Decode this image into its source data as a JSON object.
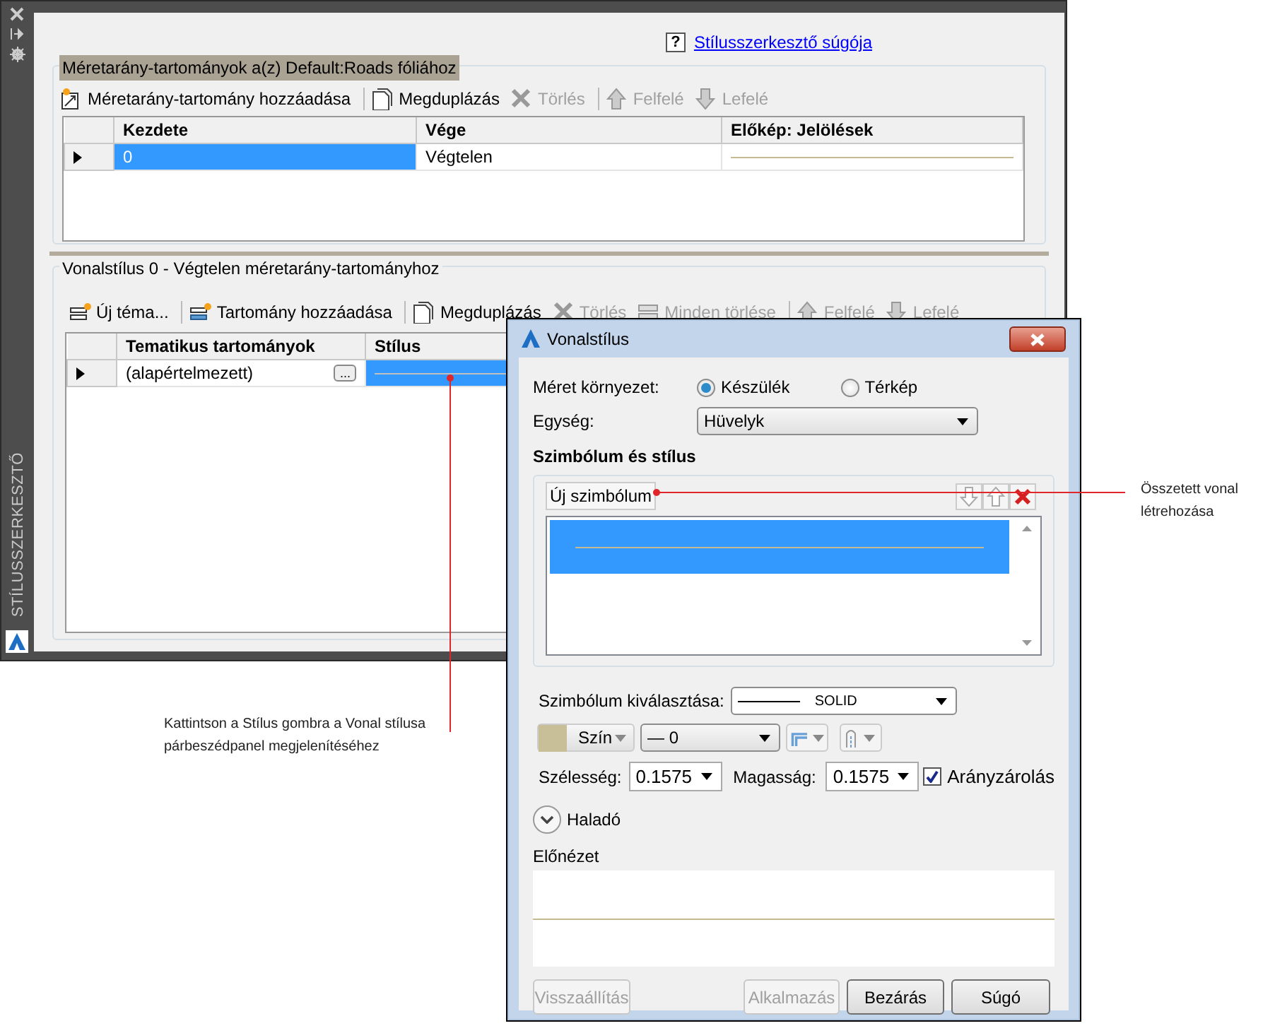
{
  "palette": {
    "side_title": "STÍLUSSZERKESZTŐ",
    "help_icon": "?",
    "help_link": "Stílusszerkesztő súgója"
  },
  "scale_ranges": {
    "title": "Méretarány-tartományok a(z) Default:Roads fóliához",
    "toolbar": [
      {
        "kind": "add",
        "label": "Méretarány-tartomány hozzáadása",
        "disabled": false
      },
      {
        "kind": "duplicate",
        "label": "Megduplázás",
        "disabled": false
      },
      {
        "kind": "delete",
        "label": "Törlés",
        "disabled": true
      },
      {
        "kind": "up",
        "label": "Felfelé",
        "disabled": true
      },
      {
        "kind": "down",
        "label": "Lefelé",
        "disabled": true
      }
    ],
    "columns": [
      "Kezdete",
      "Vége",
      "Előkép: Jelölések"
    ],
    "rows": [
      {
        "current": true,
        "cells": [
          {
            "kind": "text",
            "text": "0",
            "selected": true
          },
          {
            "kind": "text",
            "text": "Végtelen",
            "selected": false
          },
          {
            "kind": "preview",
            "selected": false
          }
        ]
      }
    ]
  },
  "line_styles": {
    "title": "Vonalstílus 0 - Végtelen méretarány-tartományhoz",
    "toolbar": [
      {
        "kind": "new-theme",
        "label": "Új téma...",
        "disabled": false
      },
      {
        "kind": "add-range",
        "label": "Tartomány hozzáadása",
        "disabled": false
      },
      {
        "kind": "duplicate",
        "label": "Megduplázás",
        "disabled": false
      },
      {
        "kind": "delete",
        "label": "Törlés",
        "disabled": true
      },
      {
        "kind": "delete-all",
        "label": "Minden törlése",
        "disabled": true
      },
      {
        "kind": "up",
        "label": "Felfelé",
        "disabled": true
      },
      {
        "kind": "down",
        "label": "Lefelé",
        "disabled": true
      }
    ],
    "columns": [
      "Tematikus tartományok",
      "Stílus"
    ],
    "rows": [
      {
        "current": true,
        "cells": [
          {
            "kind": "browse",
            "text": "(alapértelmezett)",
            "button": "...",
            "selected": false
          },
          {
            "kind": "preview",
            "selected": true
          }
        ]
      }
    ]
  },
  "dialog": {
    "title": "Vonalstílus",
    "size_context": {
      "label": "Méret környezet:",
      "options": [
        {
          "label": "Készülék",
          "selected": true
        },
        {
          "label": "Térkép",
          "selected": false
        }
      ]
    },
    "unit": {
      "label": "Egység:",
      "value": "Hüvelyk"
    },
    "symbol_section": {
      "title": "Szimbólum és stílus",
      "new_symbol_button": "Új szimbólum",
      "items": [
        {
          "selected": true
        }
      ]
    },
    "symbol_select": {
      "label": "Szimbólum kiválasztása:",
      "value": "SOLID"
    },
    "color": {
      "label": "Szín",
      "color": "#c8bf98"
    },
    "lineweight": {
      "value": "— 0"
    },
    "width": {
      "label": "Szélesség:",
      "value": "0.1575"
    },
    "height": {
      "label": "Magasság:",
      "value": "0.1575"
    },
    "aspect_lock": {
      "label": "Arányzárolás",
      "checked": true
    },
    "advanced": {
      "label": "Haladó",
      "expanded": false
    },
    "preview": {
      "label": "Előnézet"
    },
    "buttons": [
      {
        "label": "Visszaállítás",
        "disabled": true
      },
      {
        "label": "Alkalmazás",
        "disabled": true
      },
      {
        "label": "Bezárás",
        "disabled": false
      },
      {
        "label": "Súgó",
        "disabled": false
      }
    ]
  },
  "callouts": [
    {
      "text": "Kattintson a Stílus gombra a Vonal stílusa párbeszédpanel megjelenítéséhez"
    },
    {
      "text": "Összetett vonal létrehozása"
    }
  ]
}
